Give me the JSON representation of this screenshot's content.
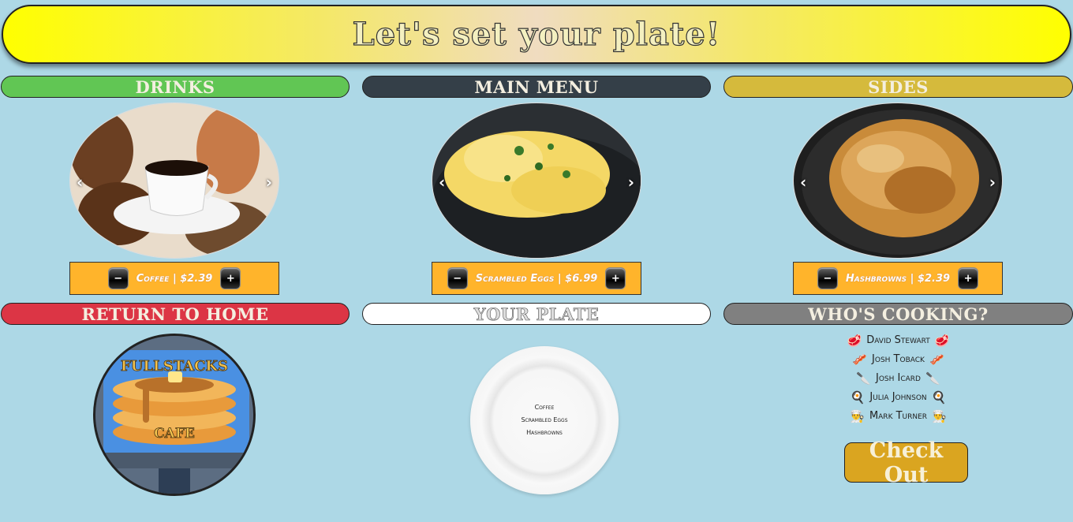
{
  "banner": {
    "title": "Let's set your plate!"
  },
  "sections": {
    "drinks": {
      "label": "DRINKS",
      "color": "#61c654"
    },
    "main": {
      "label": "MAIN MENU",
      "color": "#343f48"
    },
    "sides": {
      "label": "SIDES",
      "color": "#d5ba3c"
    },
    "home": {
      "label": "RETURN TO HOME",
      "color": "#dc3545"
    },
    "plate": {
      "label": "YOUR PLATE",
      "color": "#ffffff"
    },
    "cooking": {
      "label": "WHO'S COOKING?",
      "color": "#808080"
    }
  },
  "carousels": {
    "prev_icon": "‹",
    "next_icon": "›",
    "drinks": {
      "item": "Coffee | $2.39"
    },
    "main": {
      "item": "Scrambled Eggs | $6.99"
    },
    "sides": {
      "item": "Hashbrowns | $2.39"
    }
  },
  "controls": {
    "minus": "−",
    "plus": "+"
  },
  "logo": {
    "text_top": "FULLSTACKS",
    "text_bottom": "CAFE"
  },
  "plate_items": [
    "Coffee",
    "Scrambled Eggs",
    "Hashbrowns"
  ],
  "cooks": [
    {
      "name": "David Stewart",
      "icon": "🥩"
    },
    {
      "name": "Josh Toback",
      "icon": "🥓"
    },
    {
      "name": "Josh Icard",
      "icon": "🔪"
    },
    {
      "name": "Julia Johnson",
      "icon": "🍳"
    },
    {
      "name": "Mark Turner",
      "icon": "👨‍🍳"
    }
  ],
  "checkout": {
    "label": "Check Out"
  }
}
